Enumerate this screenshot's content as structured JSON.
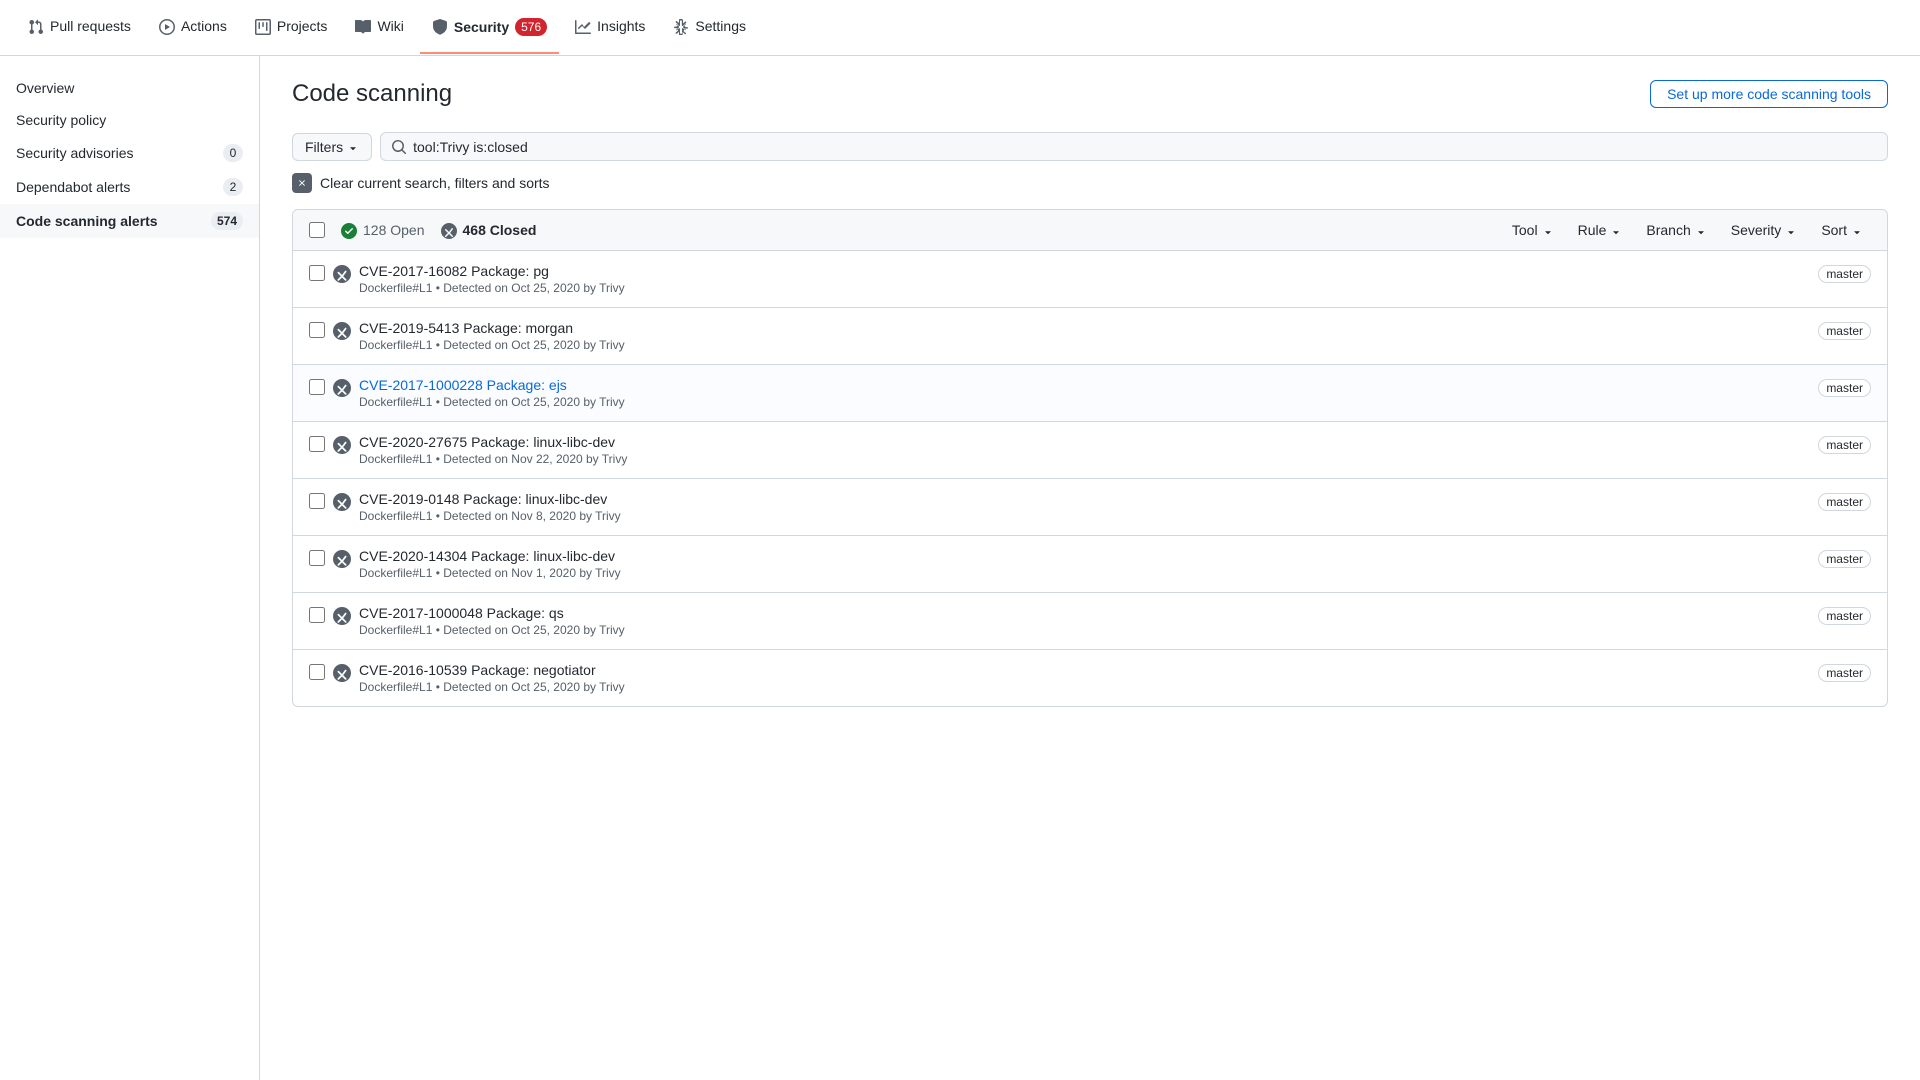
{
  "nav": {
    "tabs": [
      {
        "id": "pull-requests",
        "label": "Pull requests",
        "icon": "pull-request",
        "badge": null,
        "active": false
      },
      {
        "id": "actions",
        "label": "Actions",
        "icon": "actions",
        "badge": null,
        "active": false
      },
      {
        "id": "projects",
        "label": "Projects",
        "icon": "projects",
        "badge": null,
        "active": false
      },
      {
        "id": "wiki",
        "label": "Wiki",
        "icon": "wiki",
        "badge": null,
        "active": false
      },
      {
        "id": "security",
        "label": "Security",
        "icon": "security",
        "badge": "576",
        "active": true
      },
      {
        "id": "insights",
        "label": "Insights",
        "icon": "insights",
        "badge": null,
        "active": false
      },
      {
        "id": "settings",
        "label": "Settings",
        "icon": "settings",
        "badge": null,
        "active": false
      }
    ]
  },
  "sidebar": {
    "items": [
      {
        "id": "overview",
        "label": "Overview",
        "badge": null,
        "active": false
      },
      {
        "id": "security-policy",
        "label": "Security policy",
        "badge": null,
        "active": false
      },
      {
        "id": "security-advisories",
        "label": "Security advisories",
        "badge": "0",
        "active": false
      },
      {
        "id": "dependabot-alerts",
        "label": "Dependabot alerts",
        "badge": "2",
        "active": false
      },
      {
        "id": "code-scanning-alerts",
        "label": "Code scanning alerts",
        "badge": "574",
        "active": true
      }
    ]
  },
  "main": {
    "title": "Code scanning",
    "setup_btn": "Set up more code scanning tools",
    "filter": {
      "filters_label": "Filters",
      "search_value": "tool:Trivy is:closed"
    },
    "clear_filter": {
      "text": "Clear current search, filters and sorts"
    },
    "results_header": {
      "open_count": "128 Open",
      "closed_count": "468 Closed",
      "tool_label": "Tool",
      "rule_label": "Rule",
      "branch_label": "Branch",
      "severity_label": "Severity",
      "sort_label": "Sort"
    },
    "alerts": [
      {
        "id": 1,
        "title": "CVE-2017-16082 Package: pg",
        "is_link": false,
        "meta": "Dockerfile#L1 • Detected on Oct 25, 2020 by Trivy",
        "branch": "master"
      },
      {
        "id": 2,
        "title": "CVE-2019-5413 Package: morgan",
        "is_link": false,
        "meta": "Dockerfile#L1 • Detected on Oct 25, 2020 by Trivy",
        "branch": "master"
      },
      {
        "id": 3,
        "title": "CVE-2017-1000228 Package: ejs",
        "is_link": true,
        "meta": "Dockerfile#L1 • Detected on Oct 25, 2020 by Trivy",
        "branch": "master"
      },
      {
        "id": 4,
        "title": "CVE-2020-27675 Package: linux-libc-dev",
        "is_link": false,
        "meta": "Dockerfile#L1 • Detected on Nov 22, 2020 by Trivy",
        "branch": "master"
      },
      {
        "id": 5,
        "title": "CVE-2019-0148 Package: linux-libc-dev",
        "is_link": false,
        "meta": "Dockerfile#L1 • Detected on Nov 8, 2020 by Trivy",
        "branch": "master"
      },
      {
        "id": 6,
        "title": "CVE-2020-14304 Package: linux-libc-dev",
        "is_link": false,
        "meta": "Dockerfile#L1 • Detected on Nov 1, 2020 by Trivy",
        "branch": "master"
      },
      {
        "id": 7,
        "title": "CVE-2017-1000048 Package: qs",
        "is_link": false,
        "meta": "Dockerfile#L1 • Detected on Oct 25, 2020 by Trivy",
        "branch": "master"
      },
      {
        "id": 8,
        "title": "CVE-2016-10539 Package: negotiator",
        "is_link": false,
        "meta": "Dockerfile#L1 • Detected on Oct 25, 2020 by Trivy",
        "branch": "master"
      }
    ]
  }
}
